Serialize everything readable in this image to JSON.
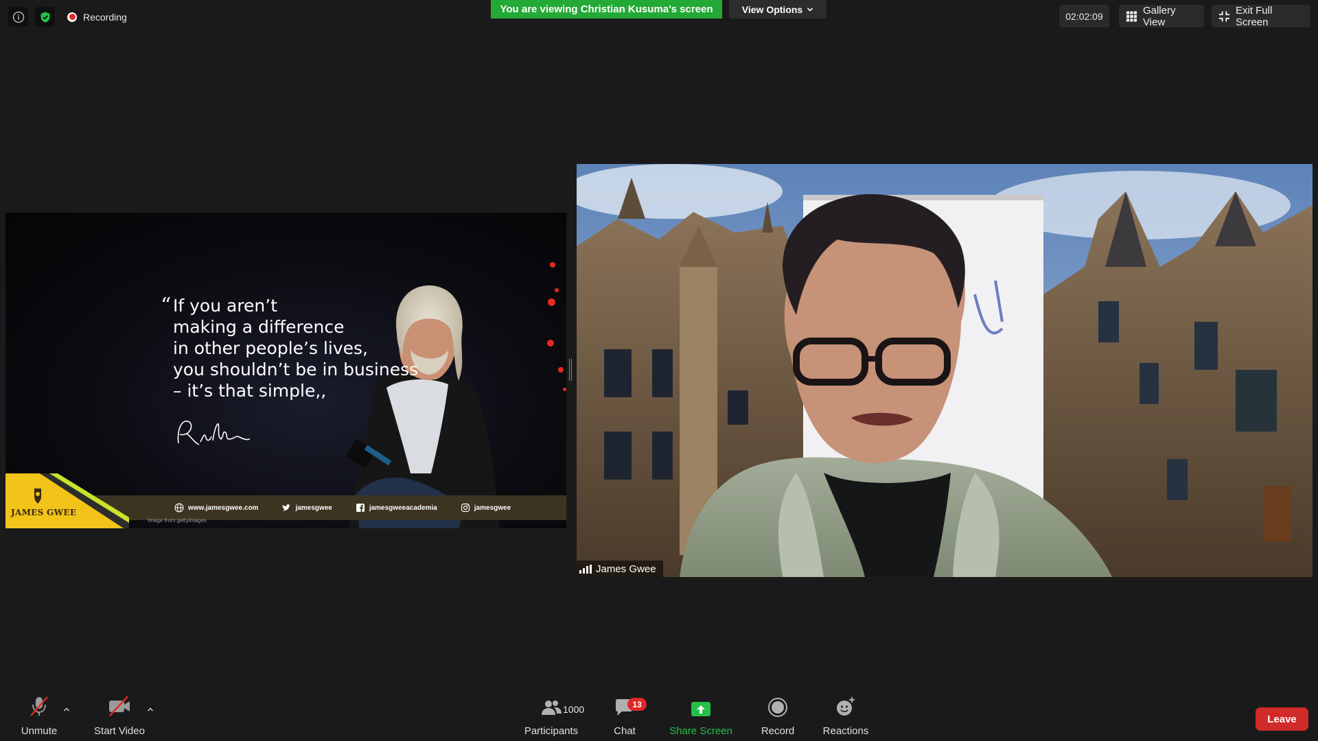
{
  "status": {
    "recording_label": "Recording"
  },
  "banner": {
    "viewing_text": "You are viewing Christian Kusuma's screen",
    "view_options_label": "View Options"
  },
  "top_right": {
    "timer": "02:02:09",
    "gallery_view_label": "Gallery View",
    "exit_full_screen_label": "Exit Full Screen"
  },
  "shared_content": {
    "quote_lines": [
      "If you aren’t",
      "making a difference",
      "in other people’s lives,",
      "you shouldn’t be in business",
      "– it’s that simple,,"
    ],
    "quote_open_mark": "“",
    "brand_name": "JAMES GWEE",
    "footer": {
      "website": "www.jamesgwee.com",
      "twitter": "jamesgwee",
      "facebook": "jamesgweeacademia",
      "instagram": "jamesgwee"
    },
    "image_credit": "Image from gettyimages"
  },
  "video": {
    "participant_name": "James Gwee"
  },
  "toolbar": {
    "unmute_label": "Unmute",
    "start_video_label": "Start Video",
    "participants_label": "Participants",
    "participants_count": "1000",
    "chat_label": "Chat",
    "chat_badge": "13",
    "share_screen_label": "Share Screen",
    "record_label": "Record",
    "reactions_label": "Reactions",
    "leave_label": "Leave"
  },
  "colors": {
    "banner_green": "#23a935",
    "share_green": "#23c14a",
    "leave_red": "#d12a2a",
    "badge_red": "#e02828",
    "brand_yellow": "#f2c318"
  }
}
